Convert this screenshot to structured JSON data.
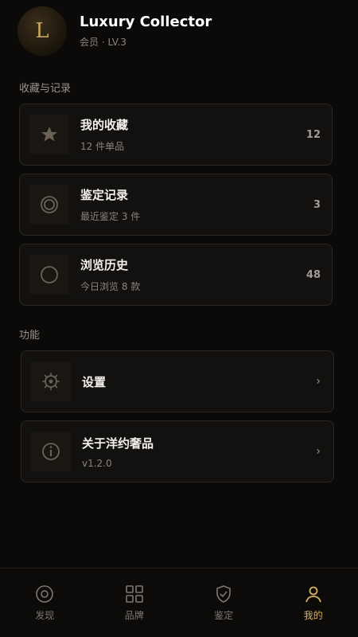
{
  "profile": {
    "avatar_letter": "L",
    "name": "Luxury Collector",
    "level": "会员 · LV.3"
  },
  "sections": {
    "collection_title": "收藏与记录",
    "functions_title": "功能"
  },
  "cards": {
    "favorites": {
      "title": "我的收藏",
      "subtitle": "12 件单品",
      "count": "12",
      "icon": "star-icon"
    },
    "authentications": {
      "title": "鉴定记录",
      "subtitle": "最近鉴定 3 件",
      "count": "3",
      "icon": "rings-icon"
    },
    "history": {
      "title": "浏览历史",
      "subtitle": "今日浏览 8 款",
      "count": "48",
      "icon": "circle-icon"
    },
    "settings": {
      "title": "设置",
      "icon": "gear-icon"
    },
    "about": {
      "title": "关于洋约奢品",
      "version": "v1.2.0",
      "icon": "info-icon"
    }
  },
  "tabs": [
    {
      "label": "发现",
      "icon": "discover-icon",
      "active": false
    },
    {
      "label": "品牌",
      "icon": "grid-icon",
      "active": false
    },
    {
      "label": "鉴定",
      "icon": "shield-icon",
      "active": false
    },
    {
      "label": "我的",
      "icon": "user-icon",
      "active": true
    }
  ],
  "colors": {
    "accent": "#d9b063",
    "background": "#0b0a09",
    "card": "#121110"
  }
}
